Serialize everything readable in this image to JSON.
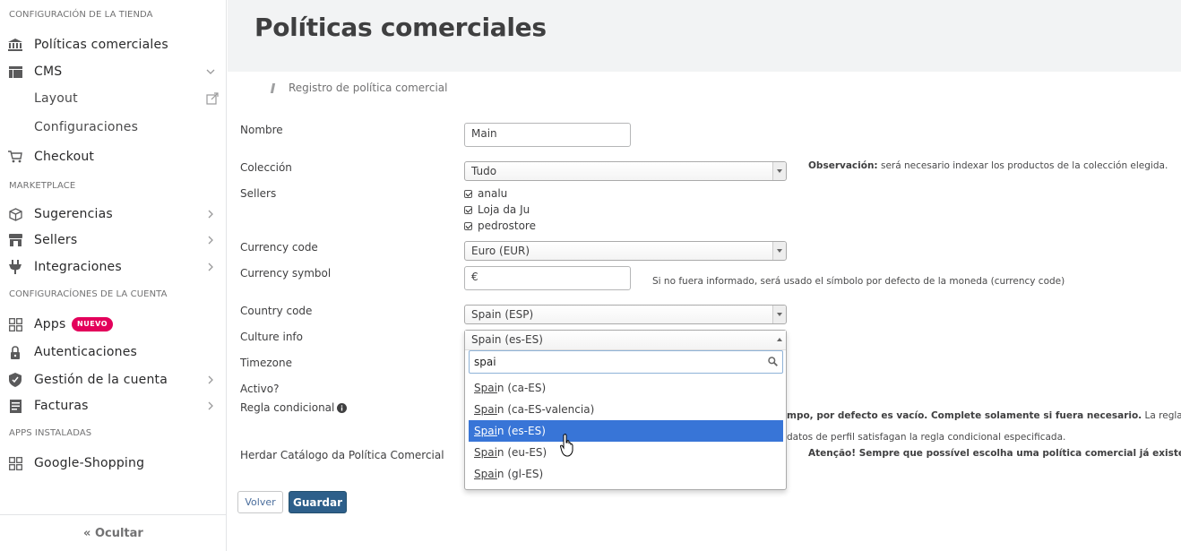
{
  "sidebar": {
    "section_store": "CONFIGURACIÓN DE LA TIENDA",
    "section_marketplace": "MARKETPLACE",
    "section_account": "CONFIGURACÍONES DE LA CUENTA",
    "section_apps": "APPS INSTALADAS",
    "items": {
      "politicas": "Políticas comerciales",
      "cms": "CMS",
      "layout": "Layout",
      "configuraciones": "Configuraciones",
      "checkout": "Checkout",
      "sugerencias": "Sugerencias",
      "sellers": "Sellers",
      "integraciones": "Integraciones",
      "apps": "Apps",
      "autenticaciones": "Autenticaciones",
      "gestion": "Gestión de la cuenta",
      "facturas": "Facturas",
      "google": "Google-Shopping"
    },
    "apps_badge": "NUEVO",
    "hide_label": "Ocultar"
  },
  "header": {
    "title": "Políticas comerciales"
  },
  "breadcrumb": "Registro de política comercial",
  "form": {
    "nombre_label": "Nombre",
    "nombre_value": "Main",
    "coleccion_label": "Colección",
    "coleccion_value": "Tudo",
    "coleccion_note_bold": "Observación:",
    "coleccion_note": " será necesario indexar los productos de la colección elegida.",
    "sellers_label": "Sellers",
    "sellers": [
      "analu",
      "Loja da Ju",
      "pedrostore"
    ],
    "currency_code_label": "Currency code",
    "currency_code_value": "Euro (EUR)",
    "currency_symbol_label": "Currency symbol",
    "currency_symbol_value": "€",
    "currency_symbol_note": "Si no fuera informado, será usado el símbolo por defecto de la moneda (currency code)",
    "country_label": "Country code",
    "country_value": "Spain (ESP)",
    "culture_label": "Culture info",
    "culture_value": "Spain (es-ES)",
    "timezone_label": "Timezone",
    "activo_label": "Activo?",
    "regla_label": "Regla condicional",
    "regla_note_bold": "mpo, por defecto es vacío. Complete solamente si fuera necesario.",
    "regla_note_rest": " La regla",
    "regla_note_line2": "datos de perfil satisfagan la regla condicional especificada.",
    "herdar_label": "Herdar Catálogo da Política Comercial",
    "herdar_note": "Atenção! Sempre que possível escolha uma política comercial já existente"
  },
  "dropdown": {
    "search_value": "spai",
    "options": [
      {
        "match": "Spai",
        "rest": "n (ca-ES)"
      },
      {
        "match": "Spai",
        "rest": "n (ca-ES-valencia)"
      },
      {
        "match": "Spai",
        "rest": "n (es-ES)"
      },
      {
        "match": "Spai",
        "rest": "n (eu-ES)"
      },
      {
        "match": "Spai",
        "rest": "n (gl-ES)"
      }
    ],
    "selected_index": 2
  },
  "buttons": {
    "back": "Volver",
    "save": "Guardar"
  },
  "colors": {
    "accent": "#3875d7",
    "save": "#2d5f8a",
    "badge": "#e3005b"
  }
}
